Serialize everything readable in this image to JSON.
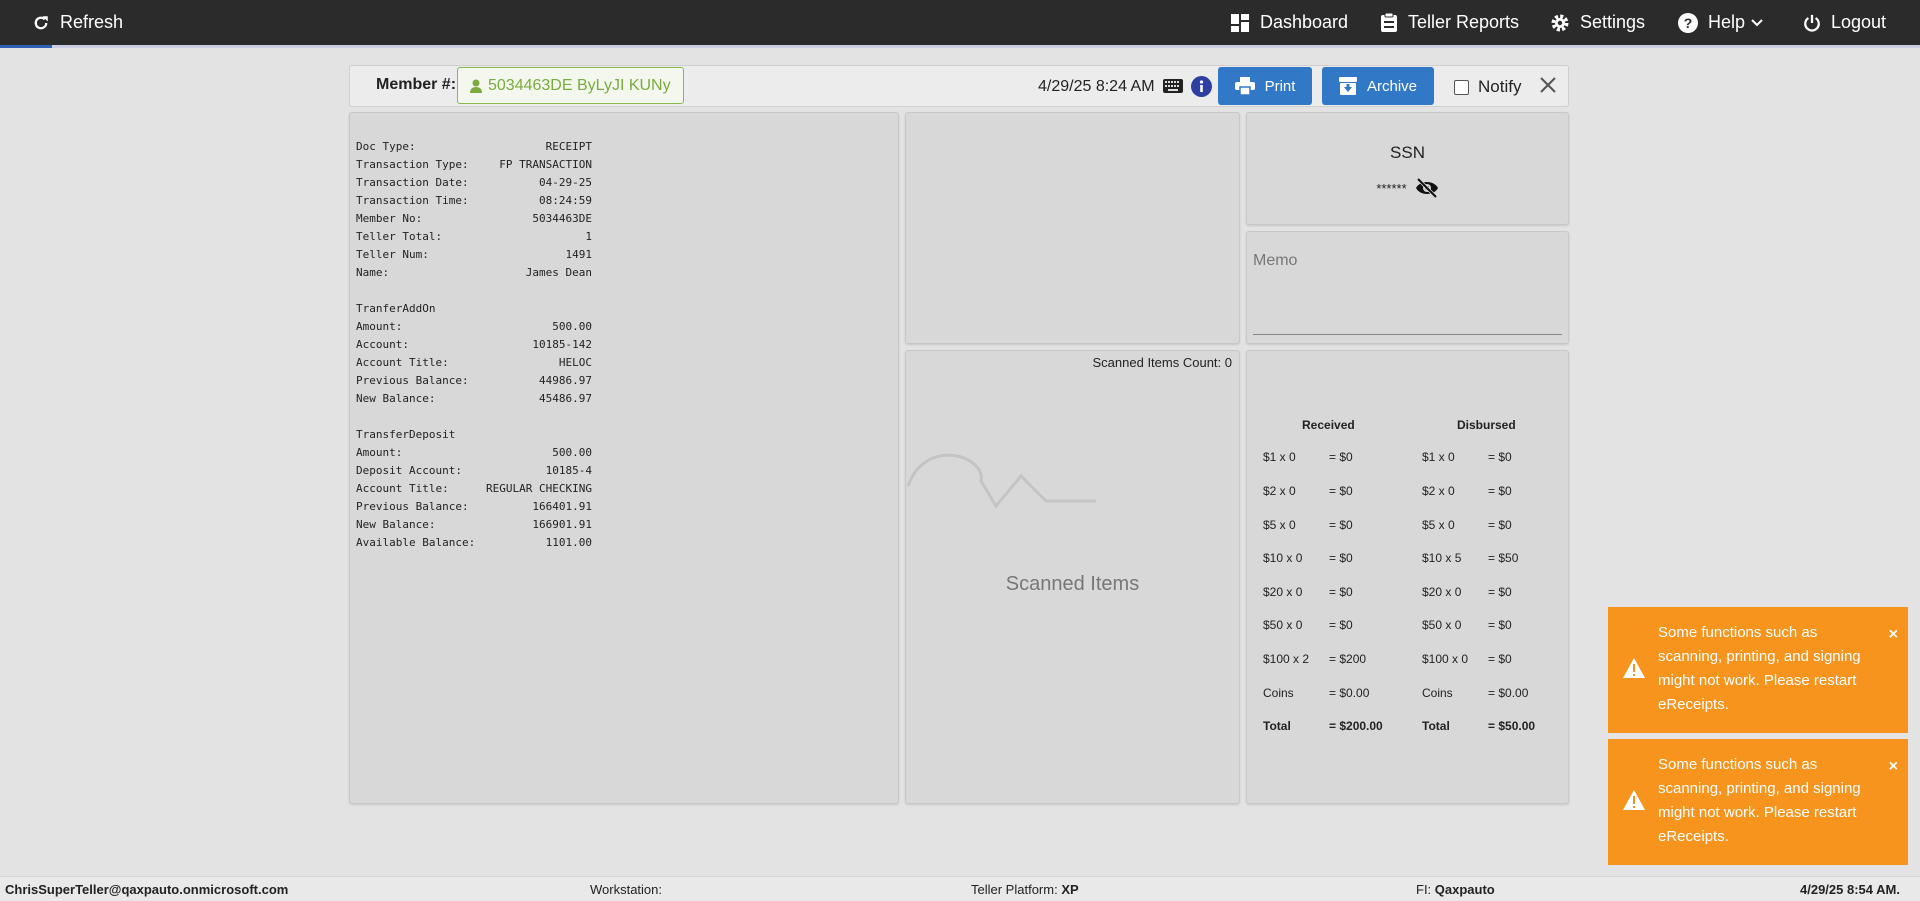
{
  "topbar": {
    "refresh": "Refresh",
    "dashboard": "Dashboard",
    "teller_reports": "Teller Reports",
    "settings": "Settings",
    "help": "Help",
    "logout": "Logout"
  },
  "member": {
    "label": "Member #:",
    "value": "5034463DE ByLyJI KUNy",
    "datetime": "4/29/25 8:24 AM",
    "print": "Print",
    "archive": "Archive",
    "notify": "Notify"
  },
  "receipt": {
    "header": [
      [
        "Doc Type:",
        "RECEIPT"
      ],
      [
        "Transaction Type:",
        "FP TRANSACTION"
      ],
      [
        "Transaction Date:",
        "04-29-25"
      ],
      [
        "Transaction Time:",
        "08:24:59"
      ],
      [
        "Member No:",
        "5034463DE"
      ],
      [
        "Teller Total:",
        "1"
      ],
      [
        "Teller Num:",
        "1491"
      ],
      [
        "Name:",
        "James Dean"
      ]
    ],
    "section1_title": "TranferAddOn",
    "section1": [
      [
        "Amount:",
        "500.00"
      ],
      [
        "Account:",
        "10185-142"
      ],
      [
        "Account Title:",
        "HELOC"
      ],
      [
        "Previous Balance:",
        "44986.97"
      ],
      [
        "New Balance:",
        "45486.97"
      ]
    ],
    "section2_title": "TransferDeposit",
    "section2": [
      [
        "Amount:",
        "500.00"
      ],
      [
        "Deposit Account:",
        "10185-4"
      ],
      [
        "Account Title:",
        "REGULAR CHECKING"
      ],
      [
        "Previous Balance:",
        "166401.91"
      ],
      [
        "New Balance:",
        "166901.91"
      ],
      [
        "Available Balance:",
        "1101.00"
      ]
    ]
  },
  "ssn": {
    "title": "SSN",
    "masked": "******"
  },
  "memo": {
    "placeholder": "Memo"
  },
  "scanned": {
    "count_label": "Scanned Items Count: 0",
    "title": "Scanned Items"
  },
  "cash": {
    "received_header": "Received",
    "disbursed_header": "Disbursed",
    "received": [
      [
        "$1 x 0",
        "= $0"
      ],
      [
        "$2 x 0",
        "= $0"
      ],
      [
        "$5 x 0",
        "= $0"
      ],
      [
        "$10 x 0",
        "= $0"
      ],
      [
        "$20 x 0",
        "= $0"
      ],
      [
        "$50 x 0",
        "= $0"
      ],
      [
        "$100 x 2",
        "= $200"
      ],
      [
        "Coins",
        "= $0.00"
      ],
      [
        "Total",
        "= $200.00"
      ]
    ],
    "disbursed": [
      [
        "$1 x 0",
        "= $0"
      ],
      [
        "$2 x 0",
        "= $0"
      ],
      [
        "$5 x 0",
        "= $0"
      ],
      [
        "$10 x 5",
        "= $50"
      ],
      [
        "$20 x 0",
        "= $0"
      ],
      [
        "$50 x 0",
        "= $0"
      ],
      [
        "$100 x 0",
        "= $0"
      ],
      [
        "Coins",
        "= $0.00"
      ],
      [
        "Total",
        "= $50.00"
      ]
    ]
  },
  "toasts": [
    {
      "message": "Some functions such as scanning, printing, and signing might not work. Please restart eReceipts.",
      "close": "×"
    },
    {
      "message": "Some functions such as scanning, printing, and signing might not work. Please restart eReceipts.",
      "close": "×"
    }
  ],
  "statusbar": {
    "user": "ChrisSuperTeller@qaxpauto.onmicrosoft.com",
    "workstation_label": "Workstation:",
    "platform_label": "Teller Platform:",
    "platform_value": "XP",
    "fi_label": "FI:",
    "fi_value": "Qaxpauto",
    "datetime": "4/29/25 8:54 AM."
  },
  "colors": {
    "topbar": "#2b2b2b",
    "primary_button": "#3178c6",
    "member_chip": "#7bab3c",
    "toast": "#f7941d"
  }
}
